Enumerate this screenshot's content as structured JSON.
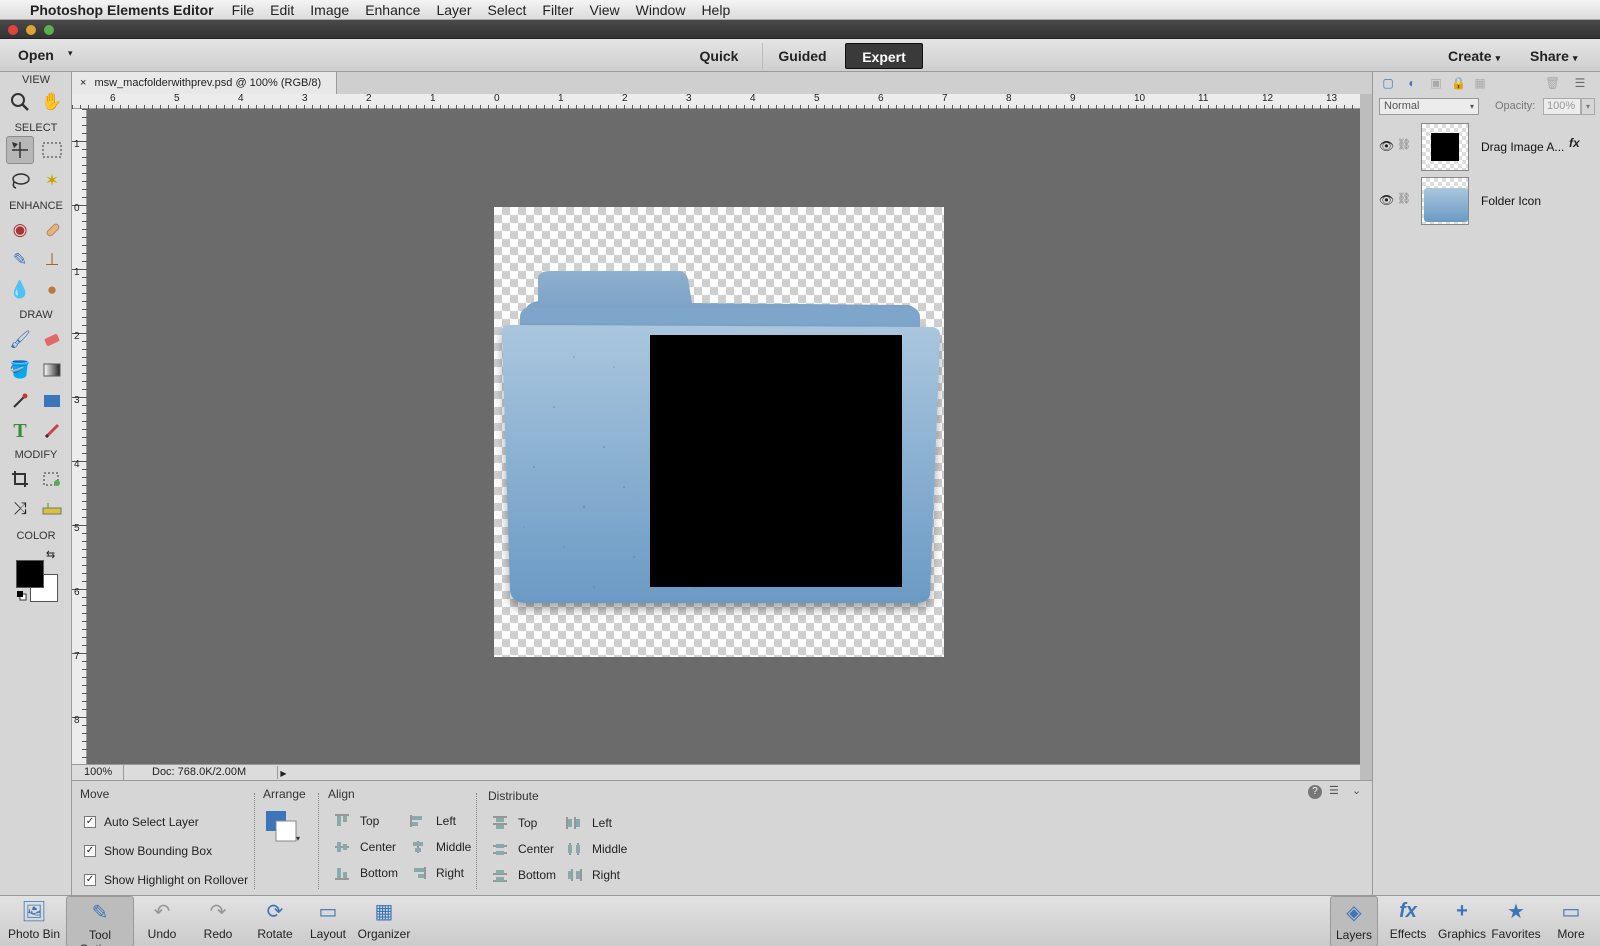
{
  "menubar": {
    "app_name": "Photoshop Elements Editor",
    "items": [
      "File",
      "Edit",
      "Image",
      "Enhance",
      "Layer",
      "Select",
      "Filter",
      "View",
      "Window",
      "Help"
    ]
  },
  "modebar": {
    "open_label": "Open",
    "modes": [
      "Quick",
      "Guided",
      "Expert"
    ],
    "active_mode": "Expert",
    "create_label": "Create",
    "share_label": "Share"
  },
  "toolbox": {
    "sections": [
      "VIEW",
      "SELECT",
      "ENHANCE",
      "DRAW",
      "MODIFY",
      "COLOR"
    ],
    "foreground_color": "#000000",
    "background_color": "#ffffff"
  },
  "document": {
    "tab_title": "msw_macfolderwithprev.psd @ 100% (RGB/8)",
    "hruler_labels": [
      "6",
      "5",
      "4",
      "3",
      "2",
      "1",
      "0",
      "1",
      "2",
      "3",
      "4",
      "5",
      "6",
      "7",
      "8",
      "9",
      "10",
      "11",
      "12",
      "13"
    ],
    "vruler_labels": [
      "1",
      "0",
      "1",
      "2",
      "3",
      "4",
      "5",
      "6",
      "7",
      "8"
    ],
    "zoom": "100%",
    "doc_info": "Doc: 768.0K/2.00M"
  },
  "tool_options": {
    "move_title": "Move",
    "checkboxes": [
      {
        "label": "Auto Select Layer",
        "checked": true
      },
      {
        "label": "Show Bounding Box",
        "checked": true
      },
      {
        "label": "Show Highlight on Rollover",
        "checked": true
      }
    ],
    "arrange_title": "Arrange",
    "align_title": "Align",
    "align_col1": [
      "Top",
      "Center",
      "Bottom"
    ],
    "align_col2": [
      "Left",
      "Middle",
      "Right"
    ],
    "distribute_title": "Distribute",
    "distribute_col1": [
      "Top",
      "Center",
      "Bottom"
    ],
    "distribute_col2": [
      "Left",
      "Middle",
      "Right"
    ]
  },
  "layers_panel": {
    "blend_mode": "Normal",
    "opacity_label": "Opacity:",
    "opacity_value": "100%",
    "layers": [
      {
        "name": "Drag Image A...",
        "has_fx": true,
        "fx_label": "fx"
      },
      {
        "name": "Folder Icon",
        "has_fx": false
      }
    ]
  },
  "bottombar": {
    "left": [
      "Photo Bin",
      "Tool Options",
      "Undo",
      "Redo",
      "Rotate",
      "Layout",
      "Organizer"
    ],
    "right": [
      "Layers",
      "Effects",
      "Graphics",
      "Favorites",
      "More"
    ],
    "active_left": "Tool Options",
    "active_right": "Layers"
  },
  "colors": {
    "canvas_bg": "#6b6b6b",
    "folder_blue": "#8fb2d2",
    "accent_blue": "#3d76b8"
  }
}
